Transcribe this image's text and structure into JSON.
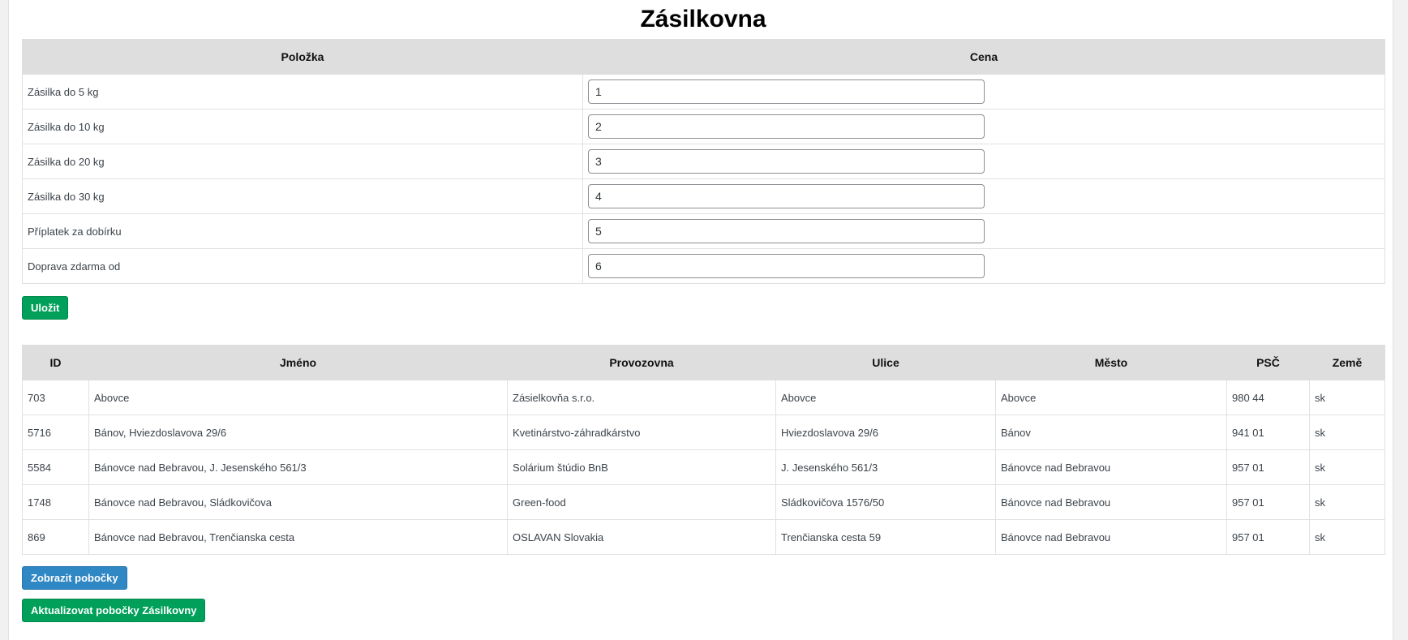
{
  "title": "Zásilkovna",
  "price_table": {
    "headers": [
      "Položka",
      "Cena"
    ],
    "rows": [
      {
        "label": "Zásilka do 5 kg",
        "value": "1"
      },
      {
        "label": "Zásilka do 10 kg",
        "value": "2"
      },
      {
        "label": "Zásilka do 20 kg",
        "value": "3"
      },
      {
        "label": "Zásilka do 30 kg",
        "value": "4"
      },
      {
        "label": "Příplatek za dobírku",
        "value": "5"
      },
      {
        "label": "Doprava zdarma od",
        "value": "6"
      }
    ]
  },
  "save_button": "Uložit",
  "branches_table": {
    "headers": [
      "ID",
      "Jméno",
      "Provozovna",
      "Ulice",
      "Město",
      "PSČ",
      "Země"
    ],
    "rows": [
      [
        "703",
        "Abovce",
        "Zásielkovňa s.r.o.",
        "Abovce",
        "Abovce",
        "980 44",
        "sk"
      ],
      [
        "5716",
        "Bánov, Hviezdoslavova 29/6",
        "Kvetinárstvo-záhradkárstvo",
        "Hviezdoslavova 29/6",
        "Bánov",
        "941 01",
        "sk"
      ],
      [
        "5584",
        "Bánovce nad Bebravou, J. Jesenského 561/3",
        "Solárium štúdio BnB",
        "J. Jesenského 561/3",
        "Bánovce nad Bebravou",
        "957 01",
        "sk"
      ],
      [
        "1748",
        "Bánovce nad Bebravou, Sládkovičova",
        "Green-food",
        "Sládkovičova 1576/50",
        "Bánovce nad Bebravou",
        "957 01",
        "sk"
      ],
      [
        "869",
        "Bánovce nad Bebravou, Trenčianska cesta",
        "OSLAVAN Slovakia",
        "Trenčianska cesta 59",
        "Bánovce nad Bebravou",
        "957 01",
        "sk"
      ]
    ]
  },
  "show_branches_button": "Zobrazit pobočky",
  "update_branches_button": "Aktualizovat pobočky Zásilkovny",
  "colors": {
    "green_button": "#00a05a",
    "blue_button": "#2f87c4",
    "header_bg": "#dedede"
  }
}
